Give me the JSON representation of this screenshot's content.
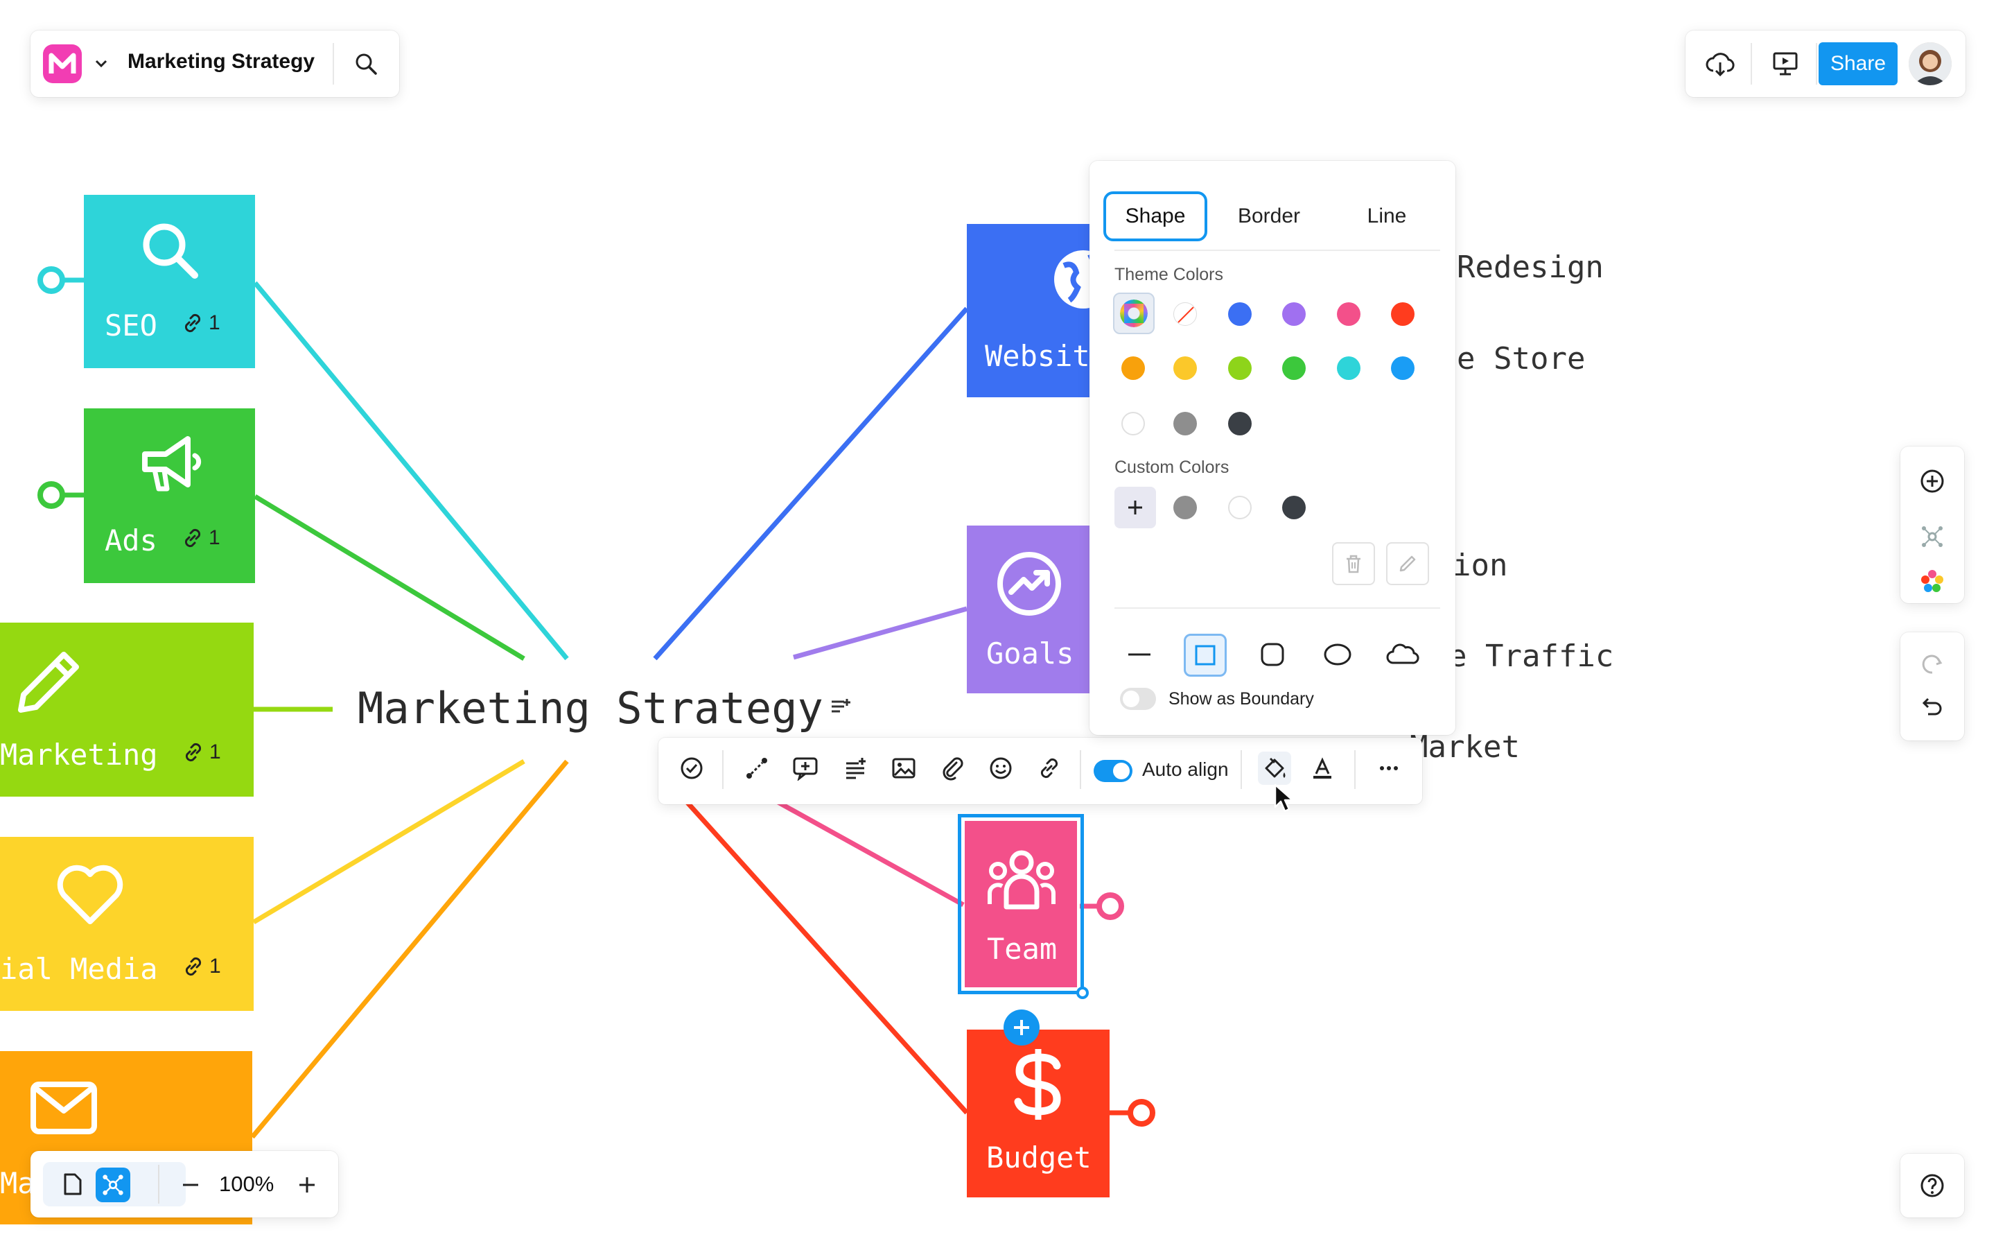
{
  "app": {
    "document_title": "Marketing Strategy",
    "share_label": "Share"
  },
  "central": {
    "title": "Marketing Strategy"
  },
  "left_nodes": [
    {
      "label": "SEO",
      "link_count": "1",
      "color": "#2ED4D9",
      "icon": "search-icon"
    },
    {
      "label": "Ads",
      "link_count": "1",
      "color": "#3CC83C",
      "icon": "megaphone-icon"
    },
    {
      "label": "Marketing",
      "link_count": "1",
      "color": "#95D911",
      "icon": "pencil-icon"
    },
    {
      "label": "ial Media",
      "link_count": "1",
      "color": "#FDD42A",
      "icon": "heart-icon"
    },
    {
      "label": "Ma",
      "color": "#FFA50A",
      "icon": "mail-icon"
    }
  ],
  "right_nodes": [
    {
      "label": "Websit",
      "color": "#3B6FF3",
      "icon": "globe-icon"
    },
    {
      "label": "Goals",
      "color": "#A07CEC",
      "icon": "trend-icon"
    },
    {
      "label": "Team",
      "color": "#F3508A",
      "icon": "team-icon"
    },
    {
      "label": "Budget",
      "color": "#FF3C1E",
      "icon": "dollar-icon"
    }
  ],
  "right_texts": [
    "Redesign",
    "e Store",
    "ion",
    "e Traffic",
    "Market"
  ],
  "panel": {
    "tabs": [
      "Shape",
      "Border",
      "Line"
    ],
    "active_tab": "Shape",
    "theme_colors_label": "Theme Colors",
    "custom_colors_label": "Custom Colors",
    "show_boundary_label": "Show as Boundary",
    "theme_colors": [
      "#3B6FF3",
      "#A070F0",
      "#F3508A",
      "#FF3C1E",
      "#F8A10C",
      "#FBC82A",
      "#8ED41A",
      "#3CC83C",
      "#2ED4D9",
      "#1A9DF5",
      "#FFFFFF",
      "#8E8E8E",
      "#3A3F45"
    ],
    "custom_colors": [
      "#8E8E8E",
      "#FFFFFF",
      "#3A3F45"
    ]
  },
  "toolbar": {
    "auto_align_label": "Auto align",
    "auto_align_on": true
  },
  "zoom": {
    "level": "100%"
  },
  "colors": {
    "accent": "#1296F0"
  }
}
